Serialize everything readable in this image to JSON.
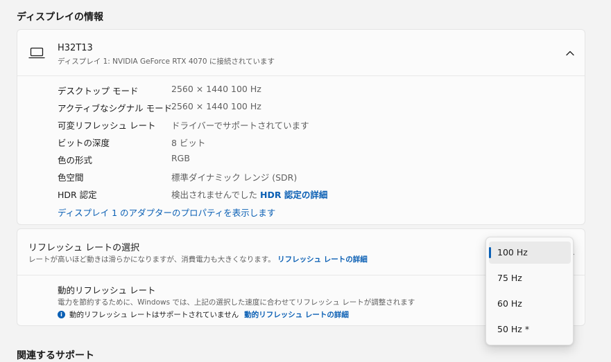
{
  "section_display_info": "ディスプレイの情報",
  "display": {
    "name": "H32T13",
    "subtitle": "ディスプレイ 1: NVIDIA GeForce RTX 4070 に接続されています",
    "icon": "laptop-icon",
    "details": [
      {
        "label": "デスクトップ モード",
        "value": "2560 × 1440 100 Hz"
      },
      {
        "label": "アクティブなシグナル モード",
        "value": "2560 × 1440 100 Hz"
      },
      {
        "label": "可変リフレッシュ レート",
        "value": "ドライバーでサポートされています"
      },
      {
        "label": "ビットの深度",
        "value": "8 ビット"
      },
      {
        "label": "色の形式",
        "value": "RGB"
      },
      {
        "label": "色空間",
        "value": "標準ダイナミック レンジ (SDR)"
      },
      {
        "label": "HDR 認定",
        "value": "検出されませんでした",
        "link": "HDR 認定の詳細"
      }
    ],
    "adapter_link": "ディスプレイ 1 のアダプターのプロパティを表示します"
  },
  "refresh": {
    "title": "リフレッシュ レートの選択",
    "subtitle": "レートが高いほど動きは滑らかになりますが、消費電力も大きくなります。",
    "subtitle_link": "リフレッシュ レートの詳細",
    "dynamic_title": "動的リフレッシュ レート",
    "dynamic_subtitle": "電力を節約するために、Windows では、上記の選択した速度に合わせてリフレッシュ レートが調整されます",
    "dynamic_note": "動的リフレッシュ レートはサポートされていません",
    "dynamic_link": "動的リフレッシュ レートの詳細",
    "options": [
      "100 Hz",
      "75 Hz",
      "60 Hz",
      "50 Hz *"
    ],
    "selected": "100 Hz"
  },
  "section_related": "関連するサポート",
  "colors": {
    "accent": "#0a5fb4",
    "background": "#f3f3f3",
    "card": "#fbfbfb"
  }
}
